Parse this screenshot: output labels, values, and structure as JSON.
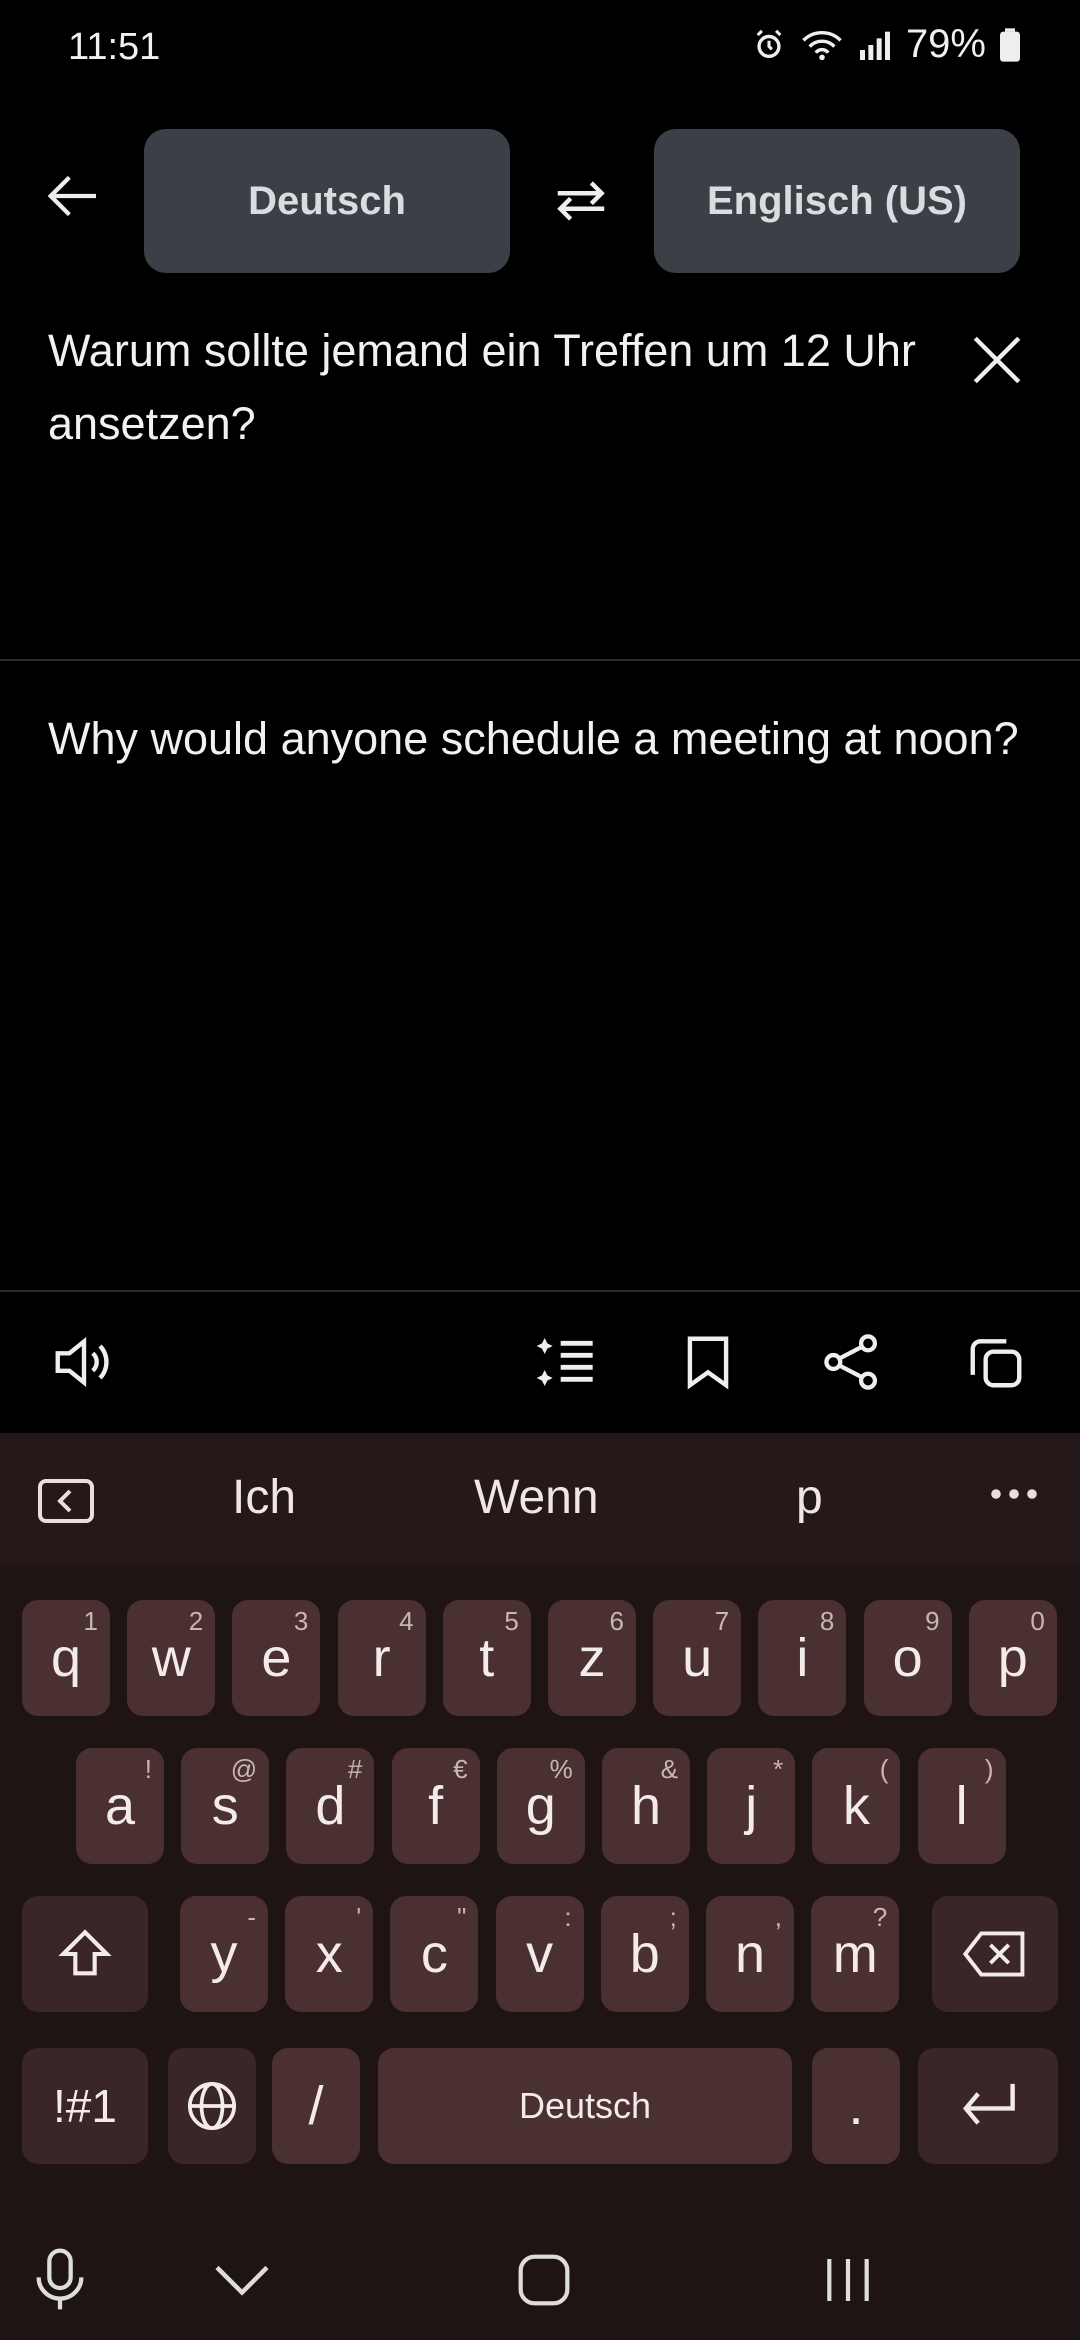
{
  "status": {
    "time": "11:51",
    "battery": "79%"
  },
  "toolbar": {
    "source_lang": "Deutsch",
    "target_lang": "Englisch (US)"
  },
  "source_text": "Warum sollte jemand ein Treffen um 12 Uhr ansetzen?",
  "target_text": "Why would anyone schedule a meeting at noon?",
  "suggestions": [
    "Ich",
    "Wenn",
    "p"
  ],
  "keyboard": {
    "row1": [
      {
        "k": "q",
        "s": "1"
      },
      {
        "k": "w",
        "s": "2"
      },
      {
        "k": "e",
        "s": "3"
      },
      {
        "k": "r",
        "s": "4"
      },
      {
        "k": "t",
        "s": "5"
      },
      {
        "k": "z",
        "s": "6"
      },
      {
        "k": "u",
        "s": "7"
      },
      {
        "k": "i",
        "s": "8"
      },
      {
        "k": "o",
        "s": "9"
      },
      {
        "k": "p",
        "s": "0"
      }
    ],
    "row2": [
      {
        "k": "a",
        "s": "!"
      },
      {
        "k": "s",
        "s": "@"
      },
      {
        "k": "d",
        "s": "#"
      },
      {
        "k": "f",
        "s": "€"
      },
      {
        "k": "g",
        "s": "%"
      },
      {
        "k": "h",
        "s": "&"
      },
      {
        "k": "j",
        "s": "*"
      },
      {
        "k": "k",
        "s": "("
      },
      {
        "k": "l",
        "s": ")"
      }
    ],
    "row3": [
      {
        "k": "y",
        "s": "-"
      },
      {
        "k": "x",
        "s": "'"
      },
      {
        "k": "c",
        "s": "\""
      },
      {
        "k": "v",
        "s": ":"
      },
      {
        "k": "b",
        "s": ";"
      },
      {
        "k": "n",
        "s": ","
      },
      {
        "k": "m",
        "s": "?"
      }
    ],
    "symbols_label": "!#1",
    "slash_label": "/",
    "space_label": "Deutsch",
    "period_label": "."
  }
}
